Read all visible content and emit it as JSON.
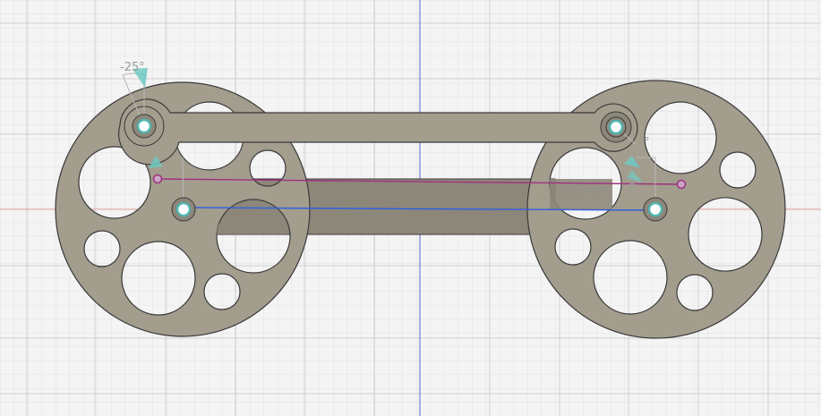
{
  "viewport": {
    "background": "#f4f4f4",
    "grid_minor_color": "#e2e2e2",
    "grid_major_color": "#cfcfcf",
    "axis_vertical_color": "#7b7bdc",
    "axis_horizontal_color": "#e59a9a"
  },
  "model": {
    "part_fill": "#a39d8e",
    "part_fill_dark": "#8d877a",
    "part_stroke": "#3a3a3a",
    "sketch_line_blue": "#2f5fe0",
    "sketch_line_magenta": "#a0307f",
    "joint_color": "#4fb5b0"
  },
  "annotations": {
    "left_angle": "-25°",
    "right_angle": "°",
    "right_angle_digit": "5"
  },
  "icons": {
    "joint_glyph": "joint-angle-icon",
    "pivot_glyph": "pivot-icon"
  }
}
